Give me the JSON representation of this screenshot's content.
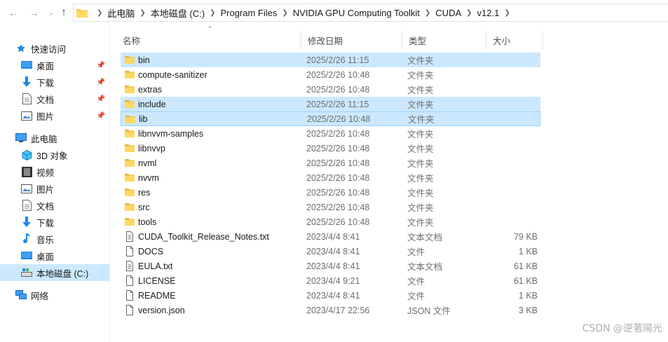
{
  "breadcrumb": [
    "此电脑",
    "本地磁盘 (C:)",
    "Program Files",
    "NVIDIA GPU Computing Toolkit",
    "CUDA",
    "v12.1"
  ],
  "nav": {
    "quick_access": "快速访问",
    "qa_items": [
      "桌面",
      "下载",
      "文档",
      "图片"
    ],
    "this_pc": "此电脑",
    "pc_items": [
      "3D 对象",
      "视频",
      "图片",
      "文档",
      "下载",
      "音乐",
      "桌面",
      "本地磁盘 (C:)"
    ],
    "network": "网络"
  },
  "columns": {
    "name": "名称",
    "date": "修改日期",
    "type": "类型",
    "size": "大小"
  },
  "files": [
    {
      "name": "bin",
      "date": "2025/2/26 11:15",
      "type": "文件夹",
      "size": "",
      "kind": "folder",
      "state": "sel"
    },
    {
      "name": "compute-sanitizer",
      "date": "2025/2/26 10:48",
      "type": "文件夹",
      "size": "",
      "kind": "folder",
      "state": ""
    },
    {
      "name": "extras",
      "date": "2025/2/26 10:48",
      "type": "文件夹",
      "size": "",
      "kind": "folder",
      "state": ""
    },
    {
      "name": "include",
      "date": "2025/2/26 11:15",
      "type": "文件夹",
      "size": "",
      "kind": "folder",
      "state": "sel"
    },
    {
      "name": "lib",
      "date": "2025/2/26 10:48",
      "type": "文件夹",
      "size": "",
      "kind": "folder",
      "state": "focus"
    },
    {
      "name": "libnvvm-samples",
      "date": "2025/2/26 10:48",
      "type": "文件夹",
      "size": "",
      "kind": "folder",
      "state": ""
    },
    {
      "name": "libnvvp",
      "date": "2025/2/26 10:48",
      "type": "文件夹",
      "size": "",
      "kind": "folder",
      "state": ""
    },
    {
      "name": "nvml",
      "date": "2025/2/26 10:48",
      "type": "文件夹",
      "size": "",
      "kind": "folder",
      "state": ""
    },
    {
      "name": "nvvm",
      "date": "2025/2/26 10:48",
      "type": "文件夹",
      "size": "",
      "kind": "folder",
      "state": ""
    },
    {
      "name": "res",
      "date": "2025/2/26 10:48",
      "type": "文件夹",
      "size": "",
      "kind": "folder",
      "state": ""
    },
    {
      "name": "src",
      "date": "2025/2/26 10:48",
      "type": "文件夹",
      "size": "",
      "kind": "folder",
      "state": ""
    },
    {
      "name": "tools",
      "date": "2025/2/26 10:48",
      "type": "文件夹",
      "size": "",
      "kind": "folder",
      "state": ""
    },
    {
      "name": "CUDA_Toolkit_Release_Notes.txt",
      "date": "2023/4/4 8:41",
      "type": "文本文档",
      "size": "79 KB",
      "kind": "text",
      "state": ""
    },
    {
      "name": "DOCS",
      "date": "2023/4/4 8:41",
      "type": "文件",
      "size": "1 KB",
      "kind": "file",
      "state": ""
    },
    {
      "name": "EULA.txt",
      "date": "2023/4/4 8:41",
      "type": "文本文档",
      "size": "61 KB",
      "kind": "text",
      "state": ""
    },
    {
      "name": "LICENSE",
      "date": "2023/4/4 9:21",
      "type": "文件",
      "size": "61 KB",
      "kind": "file",
      "state": ""
    },
    {
      "name": "README",
      "date": "2023/4/4 8:41",
      "type": "文件",
      "size": "1 KB",
      "kind": "file",
      "state": ""
    },
    {
      "name": "version.json",
      "date": "2023/4/17 22:56",
      "type": "JSON 文件",
      "size": "3 KB",
      "kind": "file",
      "state": ""
    }
  ],
  "watermark": "CSDN @逆著陽光",
  "colors": {
    "selection": "#cce8ff",
    "focus_border": "#99d1ff",
    "folder": "#f4c64e",
    "accent": "#0078d7"
  }
}
